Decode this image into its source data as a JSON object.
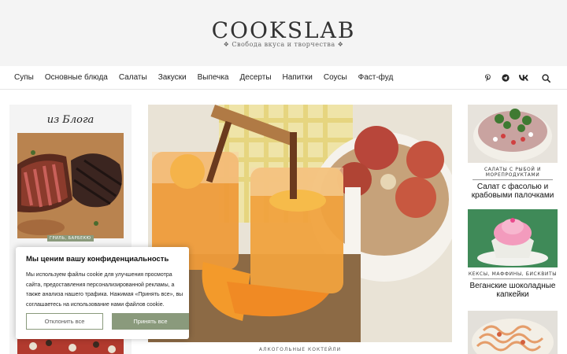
{
  "header": {
    "logo": "COOKSLAB",
    "tagline": "❖ Свобода вкуса и творчества ❖"
  },
  "nav": {
    "items": [
      {
        "label": "Супы"
      },
      {
        "label": "Основные блюда"
      },
      {
        "label": "Салаты"
      },
      {
        "label": "Закуски"
      },
      {
        "label": "Выпечка"
      },
      {
        "label": "Десерты"
      },
      {
        "label": "Напитки"
      },
      {
        "label": "Соусы"
      },
      {
        "label": "Фаст-фуд"
      }
    ],
    "icons": [
      "pinterest-icon",
      "telegram-icon",
      "vk-icon",
      "search-icon"
    ]
  },
  "sidebar": {
    "title": "из Блога",
    "post_tag": "ГРИЛЬ, БАРБЕКЮ"
  },
  "hero": {
    "category": "АЛКОГОЛЬНЫЕ КОКТЕЙЛИ"
  },
  "right_cards": [
    {
      "category": "САЛАТЫ С РЫБОЙ И МОРЕПРОДУКТАМИ",
      "title": "Салат с фасолью и крабовыми палочками"
    },
    {
      "category": "КЕКСЫ, МАФФИНЫ, БИСКВИТЫ",
      "title": "Веганские шоколадные капкейки"
    }
  ],
  "cookie": {
    "title": "Мы ценим вашу конфиденциальность",
    "text": "Мы используем файлы cookie для улучшения просмотра сайта, предоставления персонализированной рекламы, а также анализа нашего трафика. Нажимая «Принять все», вы соглашаетесь на использование нами файлов cookie.",
    "reject_label": "Отклонить все",
    "accept_label": "Принять все"
  },
  "colors": {
    "accent": "#8a9a7c",
    "header_bg": "#f4f4f4"
  }
}
